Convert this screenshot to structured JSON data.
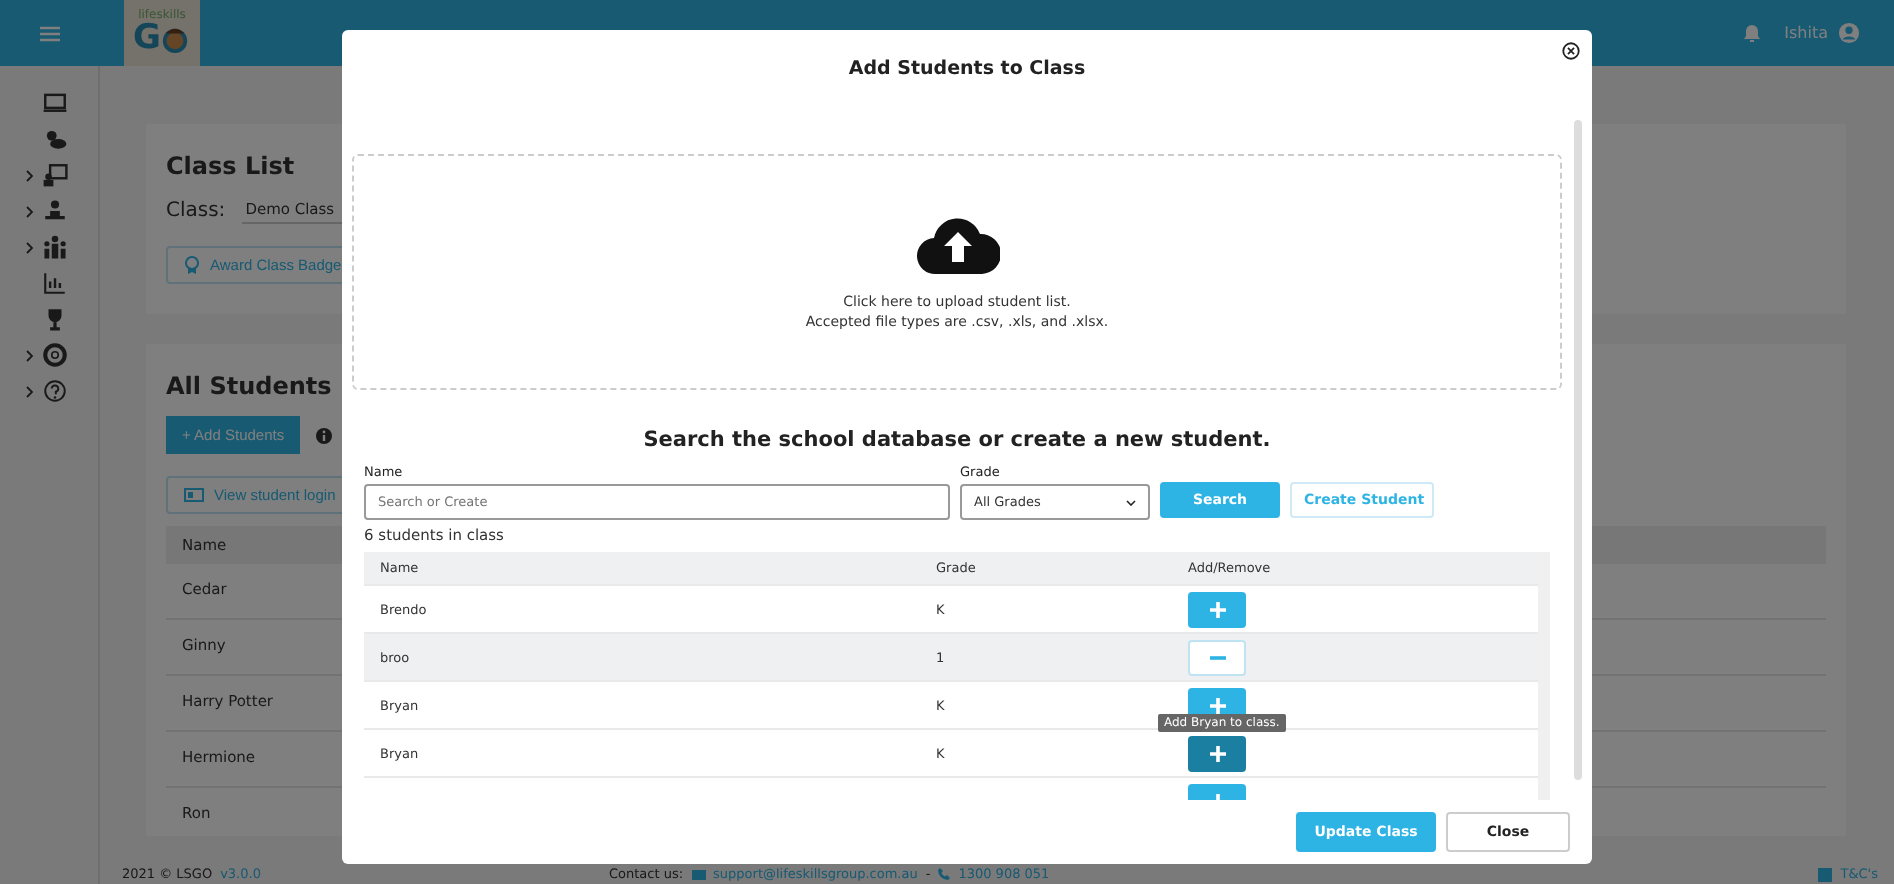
{
  "header": {
    "logo_small": "lifeskills",
    "logo_large": "G",
    "user": "Ishita"
  },
  "sidebar": {
    "items": [
      {
        "expandable": false
      },
      {
        "expandable": false
      },
      {
        "expandable": true
      },
      {
        "expandable": true
      },
      {
        "expandable": true
      },
      {
        "expandable": false
      },
      {
        "expandable": false
      },
      {
        "expandable": true
      },
      {
        "expandable": true
      }
    ]
  },
  "class_list": {
    "title": "Class List",
    "class_label": "Class:",
    "class_value": "Demo Class",
    "award_button": "Award Class Badge"
  },
  "all_students": {
    "title": "All Students",
    "add_button": "+ Add Students",
    "login_button": "View student login",
    "columns": [
      "Name"
    ],
    "rows": [
      "Cedar",
      "Ginny",
      "Harry Potter",
      "Hermione",
      "Ron"
    ]
  },
  "footer": {
    "copyright": "2021 © LSGO",
    "version": "v3.0.0",
    "contact_label": "Contact us:",
    "email": "support@lifeskillsgroup.com.au",
    "separator": "-",
    "phone": "1300 908 051",
    "terms": "T&C's"
  },
  "modal": {
    "title": "Add Students to Class",
    "upload_line_1": "Click here to upload student list.",
    "upload_line_2": "Accepted file types are .csv, .xls, and .xlsx.",
    "search_heading": "Search the school database or create a new student.",
    "name_label": "Name",
    "name_placeholder": "Search or Create",
    "grade_label": "Grade",
    "grade_value": "All Grades",
    "search_button": "Search",
    "create_button": "Create Student",
    "count": "6 students in class",
    "columns": [
      "Name",
      "Grade",
      "Add/Remove"
    ],
    "rows": [
      {
        "name": "Brendo",
        "grade": "K",
        "kind": "add",
        "hovered": false
      },
      {
        "name": "broo",
        "grade": "1",
        "kind": "remove",
        "hovered": false
      },
      {
        "name": "Bryan",
        "grade": "K",
        "kind": "add",
        "hovered": false
      },
      {
        "name": "Bryan",
        "grade": "K",
        "kind": "add",
        "hovered": true
      },
      {
        "kind": "add",
        "hovered": false
      }
    ],
    "tooltip": "Add Bryan to class.",
    "update_button": "Update Class",
    "close_button": "Close"
  }
}
